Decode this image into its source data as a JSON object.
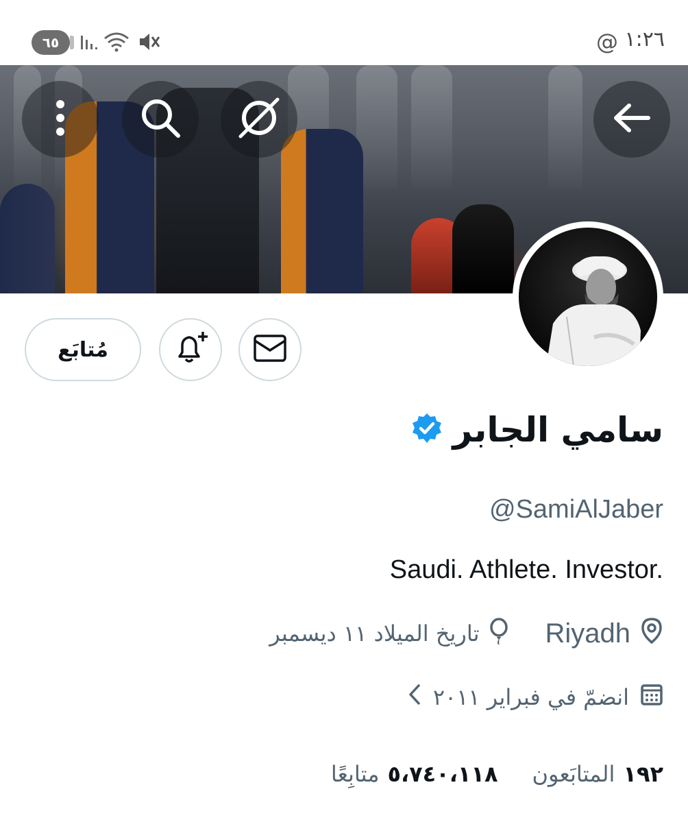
{
  "status_bar": {
    "battery": "٦٥",
    "time": "١:٢٦",
    "at_icon": "@",
    "icons": [
      "signal-icon",
      "wifi-icon",
      "mute-icon"
    ]
  },
  "banner": {
    "icons": [
      "back-arrow-icon",
      "more-vert-icon",
      "search-icon",
      "grok-icon"
    ]
  },
  "actions": {
    "follow_label": "مُتابَع",
    "icons": [
      "notification-plus-icon",
      "mail-icon"
    ]
  },
  "profile": {
    "display_name": "سامي الجابر",
    "handle": "@SamiAlJaber",
    "bio": "Saudi. Athlete. Investor.",
    "location": "Riyadh",
    "birthday": "تاريخ الميلاد ١١ ديسمبر",
    "joined": "انضمّ في فبراير ٢٠١١"
  },
  "stats": {
    "following_count": "١٩٢",
    "following_label": "المتابَعون",
    "followers_count": "٥،٧٤٠،١١٨",
    "followers_label": "متابِعًا"
  },
  "colors": {
    "verified": "#1d9bf0",
    "secondary_text": "#536471",
    "border": "#cfd9de"
  }
}
